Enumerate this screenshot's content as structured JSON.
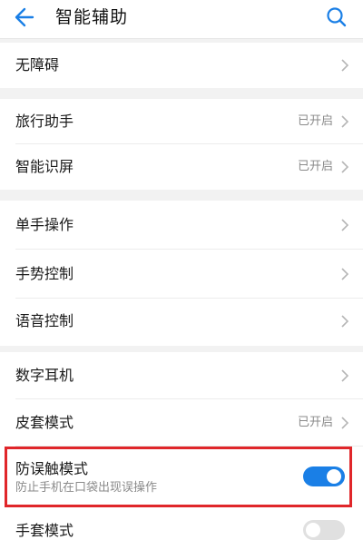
{
  "header": {
    "title": "智能辅助",
    "back_icon": "arrow-left-icon",
    "search_icon": "search-icon",
    "accent_color": "#1a7fe6"
  },
  "groups": [
    {
      "items": [
        {
          "label": "无障碍",
          "status": ""
        }
      ]
    },
    {
      "items": [
        {
          "label": "旅行助手",
          "status": "已开启"
        },
        {
          "label": "智能识屏",
          "status": "已开启"
        }
      ]
    },
    {
      "items": [
        {
          "label": "单手操作",
          "status": ""
        },
        {
          "label": "手势控制",
          "status": ""
        },
        {
          "label": "语音控制",
          "status": ""
        }
      ]
    },
    {
      "items": [
        {
          "label": "数字耳机",
          "status": ""
        },
        {
          "label": "皮套模式",
          "status": "已开启"
        },
        {
          "label": "防误触模式",
          "sublabel": "防止手机在口袋出现误操作",
          "toggle": "on"
        },
        {
          "label": "手套模式",
          "toggle": "off"
        }
      ]
    }
  ],
  "highlight_color": "#e0262a"
}
